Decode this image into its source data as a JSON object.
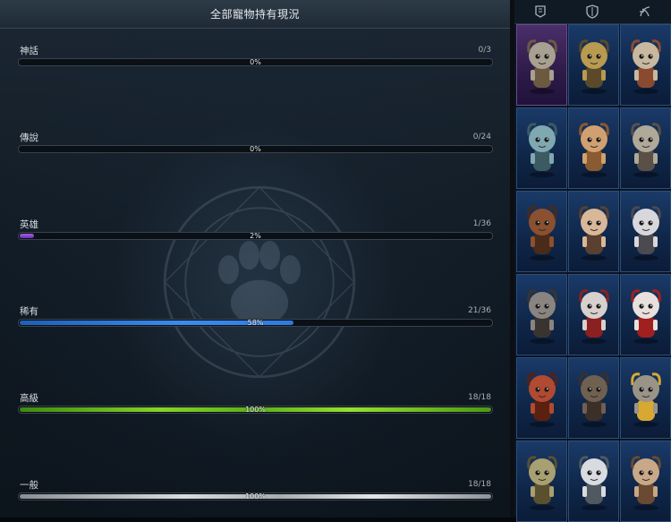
{
  "header": {
    "title": "全部寵物持有現況"
  },
  "rarity_rows": [
    {
      "label": "神話",
      "count": "0/3",
      "percent_text": "0%",
      "fill_fraction": 0.0,
      "color": "#7a3fd0"
    },
    {
      "label": "傳說",
      "count": "0/24",
      "percent_text": "0%",
      "fill_fraction": 0.0,
      "color": "#e08a20"
    },
    {
      "label": "英雄",
      "count": "1/36",
      "percent_text": "2%",
      "fill_fraction": 0.03,
      "color": "#8a4fd8"
    },
    {
      "label": "稀有",
      "count": "21/36",
      "percent_text": "58%",
      "fill_fraction": 0.58,
      "color": "#3a8cf0"
    },
    {
      "label": "高級",
      "count": "18/18",
      "percent_text": "100%",
      "fill_fraction": 1.0,
      "color": "#86d426"
    },
    {
      "label": "一般",
      "count": "18/18",
      "percent_text": "100%",
      "fill_fraction": 1.0,
      "color": "#d8dcdf"
    }
  ],
  "tabs": [
    {
      "icon": "banner-icon"
    },
    {
      "icon": "shield-icon"
    },
    {
      "icon": "swirl-icon"
    }
  ],
  "pets": [
    {
      "name": "goat-horned-pet",
      "tier": "mythic",
      "body": "#a8a090",
      "accent": "#6b5a40"
    },
    {
      "name": "gold-helmet-pet",
      "tier": "rare",
      "body": "#b89a50",
      "accent": "#5a4a2a"
    },
    {
      "name": "warrior-pet",
      "tier": "rare",
      "body": "#c8b8a0",
      "accent": "#8a4a30"
    },
    {
      "name": "ice-horned-pet",
      "tier": "rare",
      "body": "#7fa8b0",
      "accent": "#3c5a62"
    },
    {
      "name": "bearded-king-pet",
      "tier": "rare",
      "body": "#d0a070",
      "accent": "#8a5a30"
    },
    {
      "name": "ram-warrior-pet",
      "tier": "rare",
      "body": "#b0a898",
      "accent": "#5a5048"
    },
    {
      "name": "monkey-pet",
      "tier": "rare",
      "body": "#8a5030",
      "accent": "#4a2a18"
    },
    {
      "name": "elf-girl-pet",
      "tier": "rare",
      "body": "#d8b898",
      "accent": "#5a4030"
    },
    {
      "name": "white-hair-pet",
      "tier": "rare",
      "body": "#d8d8dc",
      "accent": "#4a4a50"
    },
    {
      "name": "boar-knight-pet",
      "tier": "rare",
      "body": "#8a8480",
      "accent": "#3a3430"
    },
    {
      "name": "pale-ghoul-pet",
      "tier": "rare",
      "body": "#d8d0cc",
      "accent": "#8a2020"
    },
    {
      "name": "masked-pet",
      "tier": "rare",
      "body": "#e8e0dc",
      "accent": "#a02020"
    },
    {
      "name": "red-beast-pet",
      "tier": "rare",
      "body": "#b04a30",
      "accent": "#5a2010"
    },
    {
      "name": "hooded-pet",
      "tier": "rare",
      "body": "#706050",
      "accent": "#3a3028"
    },
    {
      "name": "stone-golem-pet",
      "tier": "rare",
      "body": "#9a9488",
      "accent": "#d8a830"
    },
    {
      "name": "horned-dragon-pet",
      "tier": "rare",
      "body": "#a8a070",
      "accent": "#5a5030"
    },
    {
      "name": "silver-knight-pet",
      "tier": "rare",
      "body": "#d8dce0",
      "accent": "#505860"
    },
    {
      "name": "spiked-pet",
      "tier": "rare",
      "body": "#c8a888",
      "accent": "#6a4a30"
    }
  ]
}
